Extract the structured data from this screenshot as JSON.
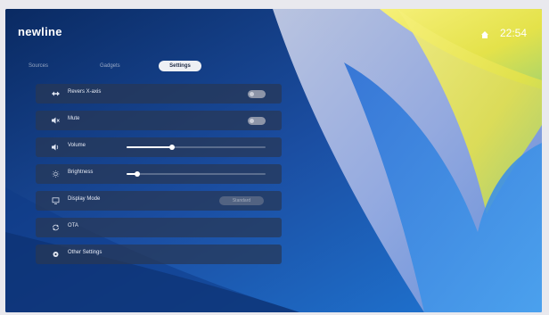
{
  "header": {
    "logo": "newline",
    "clock": "22:54"
  },
  "tabs": [
    {
      "label": "Sources",
      "active": false
    },
    {
      "label": "Gadgets",
      "active": false
    },
    {
      "label": "Settings",
      "active": true
    }
  ],
  "settings": {
    "reverse_x_axis": {
      "label": "Revers X-axis",
      "state": "off"
    },
    "mute": {
      "label": "Mute",
      "state": "off"
    },
    "volume": {
      "label": "Volume",
      "level": 0.33
    },
    "brightness": {
      "label": "Brightness",
      "level": 0.08
    },
    "display_mode": {
      "label": "Display Mode",
      "value": "Standard"
    },
    "ota": {
      "label": "OTA"
    },
    "other_settings": {
      "label": "Other Settings"
    }
  },
  "colors": {
    "row_background": "#283755",
    "active_tab": "#eef0f4",
    "accent_yellow": "#f2e93a"
  },
  "icons": [
    "home-icon",
    "arrows-horizontal-icon",
    "speaker-mute-icon",
    "speaker-icon",
    "sun-icon",
    "monitor-icon",
    "sync-icon",
    "gear-icon"
  ]
}
